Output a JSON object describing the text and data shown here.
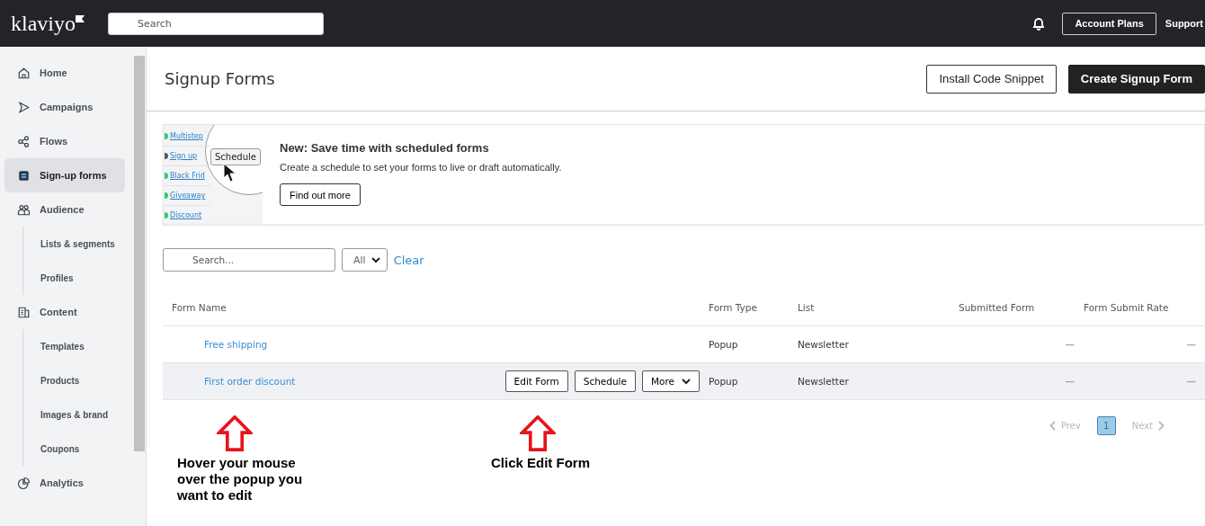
{
  "topbar": {
    "logo": "klaviyo",
    "search": {
      "placeholder": "Search"
    },
    "account_button": "Account Plans",
    "support_link": "Support"
  },
  "sidebar": {
    "items": [
      {
        "label": "Home",
        "selected": false
      },
      {
        "label": "Campaigns",
        "selected": false
      },
      {
        "label": "Flows",
        "selected": false
      },
      {
        "label": "Sign-up forms",
        "selected": true
      },
      {
        "label": "Audience",
        "selected": false,
        "children": [
          {
            "label": "Lists & segments",
            "selected": false
          },
          {
            "label": "Profiles",
            "selected": false
          }
        ]
      },
      {
        "label": "Content",
        "selected": false,
        "children": [
          {
            "label": "Templates",
            "selected": false
          },
          {
            "label": "Products",
            "selected": false
          },
          {
            "label": "Images & brand",
            "selected": false
          },
          {
            "label": "Coupons",
            "selected": false
          }
        ]
      },
      {
        "label": "Analytics",
        "selected": false
      }
    ]
  },
  "page": {
    "title": "Signup Forms",
    "buttons": [
      {
        "label": "Install Code Snippet",
        "kind": "secondary"
      },
      {
        "label": "Create Signup Form",
        "kind": "primary"
      }
    ]
  },
  "banner": {
    "illustration": {
      "list": [
        {
          "label": "Multistep",
          "color": "#2ecc71"
        },
        {
          "label": "Sign up",
          "color": "#555a60"
        },
        {
          "label": "Black Frid",
          "color": "#2ecc71"
        },
        {
          "label": "Giveaway",
          "color": "#2ecc71"
        },
        {
          "label": "Discount",
          "color": "#2ecc71"
        }
      ],
      "button": "Schedule"
    },
    "title": "New: Save time with scheduled forms",
    "text": "Create a schedule to set your forms to live or draft automatically.",
    "button": "Find out more"
  },
  "filters": {
    "search": {
      "placeholder": "Search..."
    },
    "dropdown": "All",
    "clear": "Clear"
  },
  "table": {
    "columns": [
      "Form Name",
      "Form Type",
      "List",
      "Submitted Form",
      "Form Submit Rate"
    ],
    "rows": [
      {
        "name": "Free shipping",
        "type": "Popup",
        "list": "Newsletter",
        "submitted": "—",
        "rate": "—",
        "hovered": false
      },
      {
        "name": "First order discount",
        "type": "Popup",
        "list": "Newsletter",
        "submitted": "—",
        "rate": "—",
        "hovered": true,
        "actions": [
          {
            "label": "Edit Form",
            "kind": "button"
          },
          {
            "label": "Schedule",
            "kind": "button"
          },
          {
            "label": "More",
            "kind": "dropdown"
          }
        ]
      }
    ]
  },
  "pagination": {
    "prev": {
      "label": "Prev",
      "disabled": true
    },
    "pages": [
      {
        "label": "1",
        "selected": true
      }
    ],
    "next": {
      "label": "Next",
      "disabled": true
    }
  },
  "annotations": [
    {
      "text": "Hover your mouse over the popup you want to edit",
      "kind": "left"
    },
    {
      "text": "Click Edit Form",
      "kind": "right"
    }
  ]
}
